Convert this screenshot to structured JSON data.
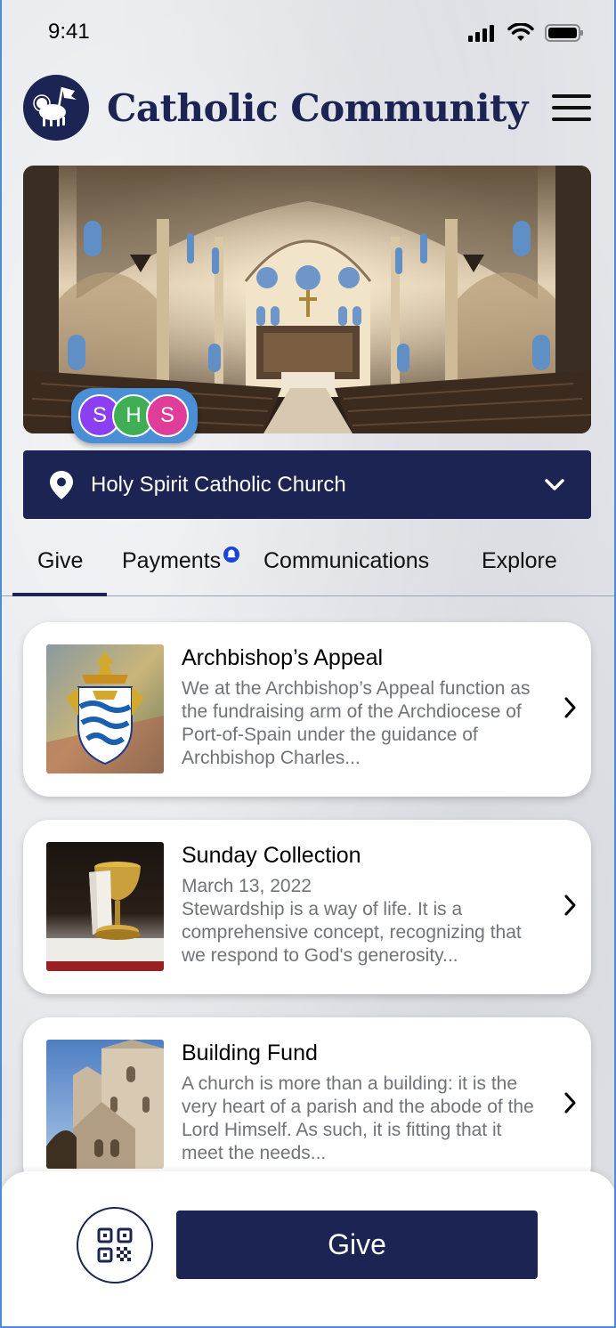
{
  "status_bar": {
    "time": "9:41"
  },
  "app": {
    "title": "Catholic Community"
  },
  "avatars": [
    {
      "initial": "S",
      "color": "#8b3ff0"
    },
    {
      "initial": "H",
      "color": "#3fae55"
    },
    {
      "initial": "S",
      "color": "#e03c9a"
    }
  ],
  "church_selector": {
    "name": "Holy Spirit Catholic Church"
  },
  "tabs": [
    {
      "label": "Give",
      "active": true
    },
    {
      "label": "Payments",
      "has_notification": true
    },
    {
      "label": "Communications"
    },
    {
      "label": "Explore"
    }
  ],
  "cards": [
    {
      "title": "Archbishop’s Appeal",
      "description": "We at the Archbishop’s Appeal function as the fundraising arm of the Archdiocese of Port-of-Spain under the guidance of Archbishop Charles..."
    },
    {
      "title": "Sunday Collection",
      "description": "March 13, 2022\nStewardship is a way of life. It is a comprehensive concept, recognizing that we respond to God's generosity..."
    },
    {
      "title": "Building Fund",
      "description": "A church is more than a building: it is the very heart of a parish and the abode of the Lord Himself.  As such, it is fitting that it meet the needs..."
    }
  ],
  "bottom_bar": {
    "give_label": "Give"
  },
  "colors": {
    "navy": "#1b2452",
    "accent_blue": "#4a8fd6",
    "notification_blue": "#1a44d6"
  }
}
